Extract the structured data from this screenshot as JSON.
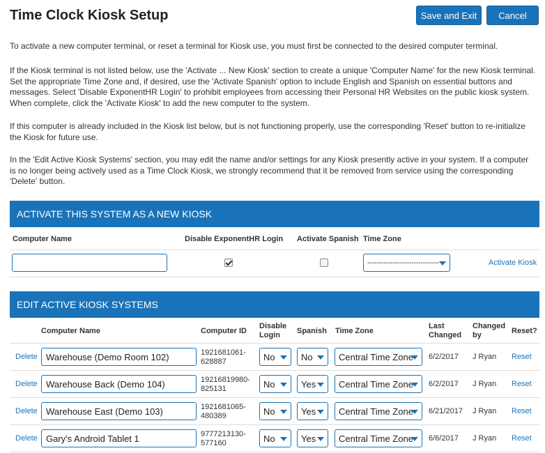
{
  "page": {
    "title": "Time Clock Kiosk Setup",
    "save_label": "Save and Exit",
    "cancel_label": "Cancel"
  },
  "instructions": [
    "To activate a new computer terminal, or reset a terminal for Kiosk use, you must first be connected to the desired computer terminal.",
    "If the Kiosk terminal is not listed below, use the 'Activate ... New Kiosk' section to create a unique 'Computer Name' for the new Kiosk terminal. Set the appropriate Time Zone and, if desired, use the 'Activate Spanish' option to include English and Spanish on essential buttons and messages. Select 'Disable ExponentHR Login' to prohibit employees from accessing their Personal HR Websites on the public kiosk system. When complete, click the 'Activate Kiosk' to add the new computer to the system.",
    "If this computer is already included in the Kiosk list below, but is not functioning properly, use the corresponding 'Reset' button to re-initialize the Kiosk for future use.",
    "In the 'Edit Active Kiosk Systems' section, you may edit the name and/or settings for any Kiosk presently active in your system. If a computer is no longer being actively used as a Time Clock Kiosk, we strongly recommend that it be removed from service using the corresponding 'Delete' button."
  ],
  "activate": {
    "heading": "ACTIVATE THIS SYSTEM AS A NEW KIOSK",
    "col_computer_name": "Computer Name",
    "col_disable_login": "Disable ExponentHR Login",
    "col_activate_spanish": "Activate Spanish",
    "col_time_zone": "Time Zone",
    "computer_name_value": "",
    "disable_login_checked": true,
    "activate_spanish_checked": false,
    "time_zone_value": "-------------------------------",
    "activate_link": "Activate Kiosk"
  },
  "edit": {
    "heading": "EDIT ACTIVE KIOSK SYSTEMS",
    "columns": {
      "computer_name": "Computer Name",
      "computer_id": "Computer ID",
      "disable_login_1": "Disable",
      "disable_login_2": "Login",
      "spanish": "Spanish",
      "time_zone": "Time Zone",
      "last_changed_1": "Last",
      "last_changed_2": "Changed",
      "changed_by_1": "Changed",
      "changed_by_2": "by",
      "reset": "Reset?"
    },
    "delete_label": "Delete",
    "reset_label": "Reset",
    "rows": [
      {
        "name": "Warehouse (Demo Room 102)",
        "id_1": "1921681061-",
        "id_2": "628887",
        "disable_login": "No",
        "spanish": "No",
        "time_zone": "Central Time Zone",
        "last_changed": "6/2/2017",
        "changed_by": "J Ryan"
      },
      {
        "name": "Warehouse Back (Demo 104)",
        "id_1": "19216819980-",
        "id_2": "825131",
        "disable_login": "No",
        "spanish": "Yes",
        "time_zone": "Central Time Zone",
        "last_changed": "6/2/2017",
        "changed_by": "J Ryan"
      },
      {
        "name": "Warehouse East (Demo 103)",
        "id_1": "1921681065-",
        "id_2": "480389",
        "disable_login": "No",
        "spanish": "Yes",
        "time_zone": "Central Time Zone",
        "last_changed": "6/21/2017",
        "changed_by": "J Ryan"
      },
      {
        "name": "Gary's Android Tablet 1",
        "id_1": "9777213130-",
        "id_2": "577160",
        "disable_login": "No",
        "spanish": "Yes",
        "time_zone": "Central Time Zone",
        "last_changed": "6/6/2017",
        "changed_by": "J Ryan"
      }
    ]
  },
  "colors": {
    "accent": "#1a73b8",
    "text": "#333333",
    "divider": "#dddddd"
  },
  "icons": {
    "dropdown": "chevron-down-icon",
    "checkbox": "checkbox-icon"
  }
}
